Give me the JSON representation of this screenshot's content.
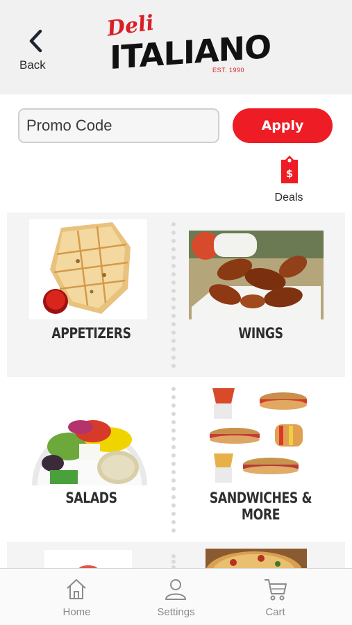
{
  "header": {
    "back_label": "Back",
    "logo": {
      "script": "Deli",
      "main": "ITALIANO",
      "est": "EST. 1990"
    }
  },
  "promo": {
    "placeholder": "Promo Code",
    "apply_label": "Apply"
  },
  "deals": {
    "label": "Deals",
    "icon": "price-tag-icon"
  },
  "categories": [
    {
      "label": "APPETIZERS"
    },
    {
      "label": "WINGS"
    },
    {
      "label": "SALADS"
    },
    {
      "label": "SANDWICHES & MORE"
    }
  ],
  "tabs": [
    {
      "label": "Home",
      "icon": "home-icon"
    },
    {
      "label": "Settings",
      "icon": "user-icon"
    },
    {
      "label": "Cart",
      "icon": "cart-icon"
    }
  ],
  "colors": {
    "accent": "#ee1c25",
    "header_bg": "#f1f1f1",
    "tab_text": "#8b8b8b"
  }
}
